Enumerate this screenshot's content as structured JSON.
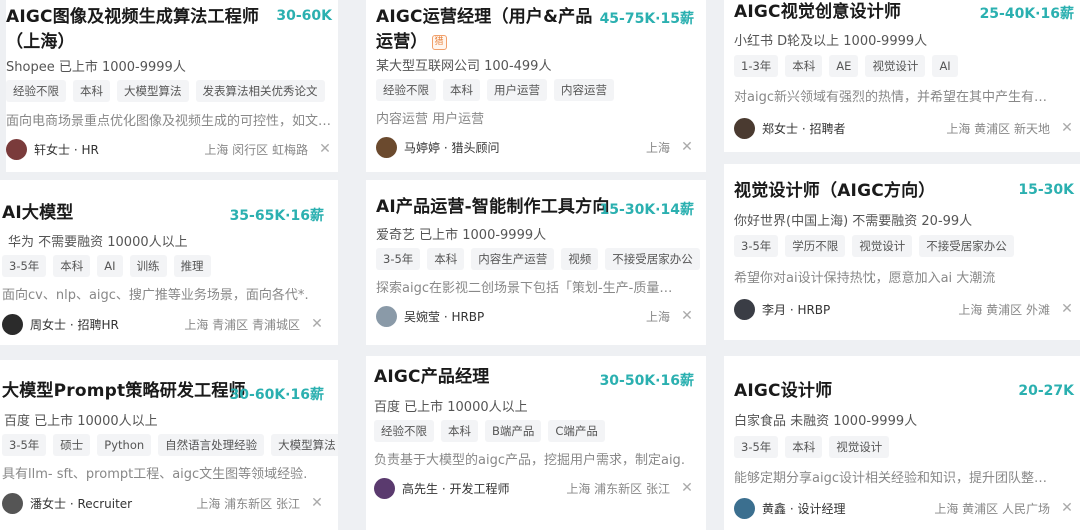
{
  "cards": [
    {
      "title": "AIGC图像及视频生成算法工程师（上海）",
      "salary": "30-60K",
      "company": "Shopee 已上市 1000-9999人",
      "tags": [
        "经验不限",
        "本科",
        "大模型算法",
        "发表算法相关优秀论文"
      ],
      "desc": "面向电商场景重点优化图像及视频生成的可控性，如文…",
      "recruiter": "轩女士 · HR",
      "location": "上海 闵行区 虹梅路",
      "avatar_color": "#7a3b3b"
    },
    {
      "title": "AIGC运营经理（用户&产品运营）",
      "badge": "猎",
      "salary": "45-75K·15薪",
      "company": "某大型互联网公司 100-499人",
      "tags": [
        "经验不限",
        "本科",
        "用户运营",
        "内容运营"
      ],
      "desc": "内容运营 用户运营",
      "recruiter": "马婷婷 · 猎头顾问",
      "location": "上海",
      "avatar_color": "#6b4a2e"
    },
    {
      "title": "AIGC视觉创意设计师",
      "salary": "25-40K·16薪",
      "company": "小红书 D轮及以上 1000-9999人",
      "tags": [
        "1-3年",
        "本科",
        "AE",
        "视觉设计",
        "AI"
      ],
      "desc": "对aigc新兴领域有强烈的热情，并希望在其中产生有…",
      "recruiter": "郑女士 · 招聘者",
      "location": "上海 黄浦区 新天地",
      "avatar_color": "#4a3a30"
    },
    {
      "title": "AI大模型",
      "salary": "35-65K·16薪",
      "company": "华为 不需要融资 10000人以上",
      "tags": [
        "3-5年",
        "本科",
        "AI",
        "训练",
        "推理"
      ],
      "desc": "面向cv、nlp、aigc、搜广推等业务场景，面向各代*…",
      "recruiter": "周女士 · 招聘HR",
      "location": "上海 青浦区 青浦城区",
      "avatar_color": "#2b2b2b"
    },
    {
      "title": "AI产品运营-智能制作工具方向",
      "salary": "15-30K·14薪",
      "company": "爱奇艺 已上市 1000-9999人",
      "tags": [
        "3-5年",
        "本科",
        "内容生产运营",
        "视频",
        "不接受居家办公"
      ],
      "desc": "探索aigc在影视二创场景下包括「策划-生产-质量…",
      "recruiter": "吴婉莹 · HRBP",
      "location": "上海",
      "avatar_color": "#8a9aa8"
    },
    {
      "title": "视觉设计师（AIGC方向）",
      "salary": "15-30K",
      "company": "你好世界(中国上海) 不需要融资 20-99人",
      "tags": [
        "3-5年",
        "学历不限",
        "视觉设计",
        "不接受居家办公"
      ],
      "desc": "希望你对ai设计保持热忱，愿意加入ai 大潮流",
      "recruiter": "李月 · HRBP",
      "location": "上海 黄浦区 外滩",
      "avatar_color": "#3a3d45"
    },
    {
      "title": "大模型Prompt策略研发工程师",
      "salary": "30-60K·16薪",
      "company": "百度 已上市 10000人以上",
      "tags": [
        "3-5年",
        "硕士",
        "Python",
        "自然语言处理经验",
        "大模型算法"
      ],
      "desc": "具有llm- sft、prompt工程、aigc文生图等领域经验…",
      "recruiter": "潘女士 · Recruiter",
      "location": "上海 浦东新区 张江",
      "avatar_color": "#555555"
    },
    {
      "title": "AIGC产品经理",
      "salary": "30-50K·16薪",
      "company": "百度 已上市 10000人以上",
      "tags": [
        "经验不限",
        "本科",
        "B端产品",
        "C端产品"
      ],
      "desc": "负责基于大模型的aigc产品，挖掘用户需求，制定aig…",
      "recruiter": "高先生 · 开发工程师",
      "location": "上海 浦东新区 张江",
      "avatar_color": "#5a3a6e"
    },
    {
      "title": "AIGC设计师",
      "salary": "20-27K",
      "company": "白家食品 未融资 1000-9999人",
      "tags": [
        "3-5年",
        "本科",
        "视觉设计"
      ],
      "desc": "能够定期分享aigc设计相关经验和知识，提升团队整…",
      "recruiter": "黄鑫 · 设计经理",
      "location": "上海 黄浦区 人民广场",
      "avatar_color": "#3b6f8f"
    }
  ]
}
